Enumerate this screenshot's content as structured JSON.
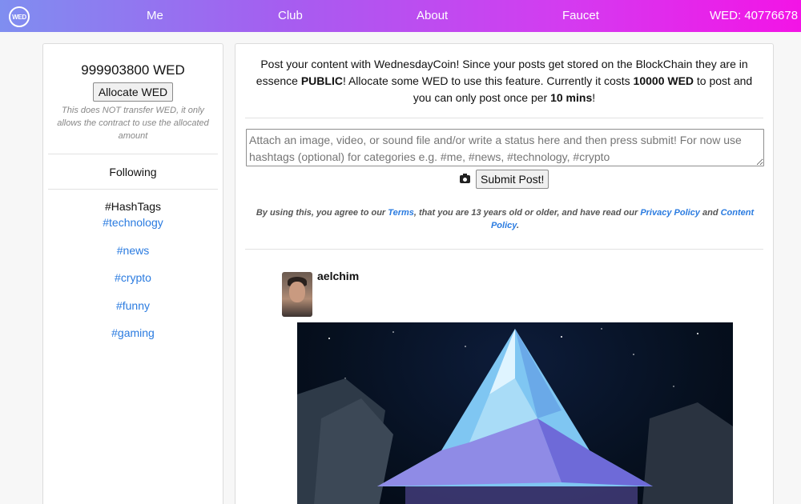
{
  "nav": {
    "logo": "WED",
    "links": [
      "Me",
      "Club",
      "About",
      "Faucet"
    ],
    "balance": "WED: 40776678"
  },
  "sidebar": {
    "balance": "999903800 WED",
    "allocate_label": "Allocate WED",
    "allocate_note": "This does NOT transfer WED, it only allows the contract to use the allocated amount",
    "following": "Following",
    "hashtags_title": "#HashTags",
    "hashtags": [
      "#technology",
      "#news",
      "#crypto",
      "#funny",
      "#gaming"
    ]
  },
  "main": {
    "intro": {
      "part1": "Post your content with WednesdayCoin! Since your posts get stored on the BlockChain they are in essence ",
      "public": "PUBLIC",
      "part2": "! Allocate some WED to use this feature. Currently it costs ",
      "cost": "10000 WED",
      "part3": " to post and you can only post once per ",
      "interval": "10 mins",
      "part4": "!"
    },
    "composer_placeholder": "Attach an image, video, or sound file and/or write a status here and then press submit! For now use hashtags (optional) for categories e.g. #me, #news, #technology, #crypto",
    "submit_label": "Submit Post!",
    "camera_icon": "camera-icon",
    "terms": {
      "part1": "By using this, you agree to our ",
      "terms_link": "Terms",
      "part2": ", that you are 13 years old or older, and have read our ",
      "privacy_link": "Privacy Policy",
      "part3": " and ",
      "content_link": "Content Policy",
      "part4": "."
    },
    "post": {
      "author": "aelchim"
    }
  },
  "colors": {
    "nav_gradient_start": "#7f8ef0",
    "nav_gradient_end": "#f314e6",
    "link": "#2a7be0"
  }
}
